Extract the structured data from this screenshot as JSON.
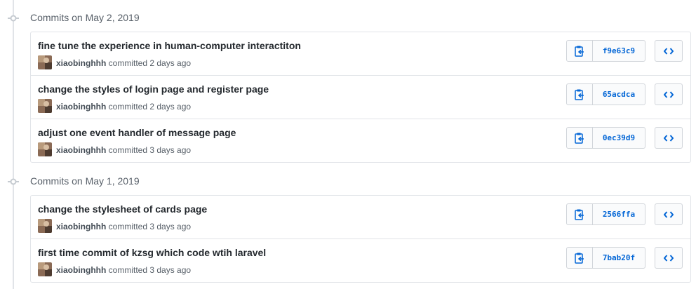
{
  "groups": [
    {
      "title": "Commits on May 2, 2019",
      "commits": [
        {
          "message": "fine tune the experience in human-computer interactiton",
          "author": "xiaobinghhh",
          "committed": "committed 2 days ago",
          "sha": "f9e63c9"
        },
        {
          "message": "change the styles of login page and register page",
          "author": "xiaobinghhh",
          "committed": "committed 2 days ago",
          "sha": "65acdca"
        },
        {
          "message": "adjust one event handler of message page",
          "author": "xiaobinghhh",
          "committed": "committed 3 days ago",
          "sha": "0ec39d9"
        }
      ]
    },
    {
      "title": "Commits on May 1, 2019",
      "commits": [
        {
          "message": "change the stylesheet of cards page",
          "author": "xiaobinghhh",
          "committed": "committed 3 days ago",
          "sha": "2566ffa"
        },
        {
          "message": "first time commit of kzsg which code wtih laravel",
          "author": "xiaobinghhh",
          "committed": "committed 3 days ago",
          "sha": "7bab20f"
        }
      ]
    }
  ],
  "icons": {
    "commit_node": "git-commit-icon",
    "copy": "clipboard-icon",
    "browse": "code-icon"
  },
  "colors": {
    "sha_link": "#0366d6",
    "border": "#e1e4e8",
    "muted_text": "#586069"
  }
}
